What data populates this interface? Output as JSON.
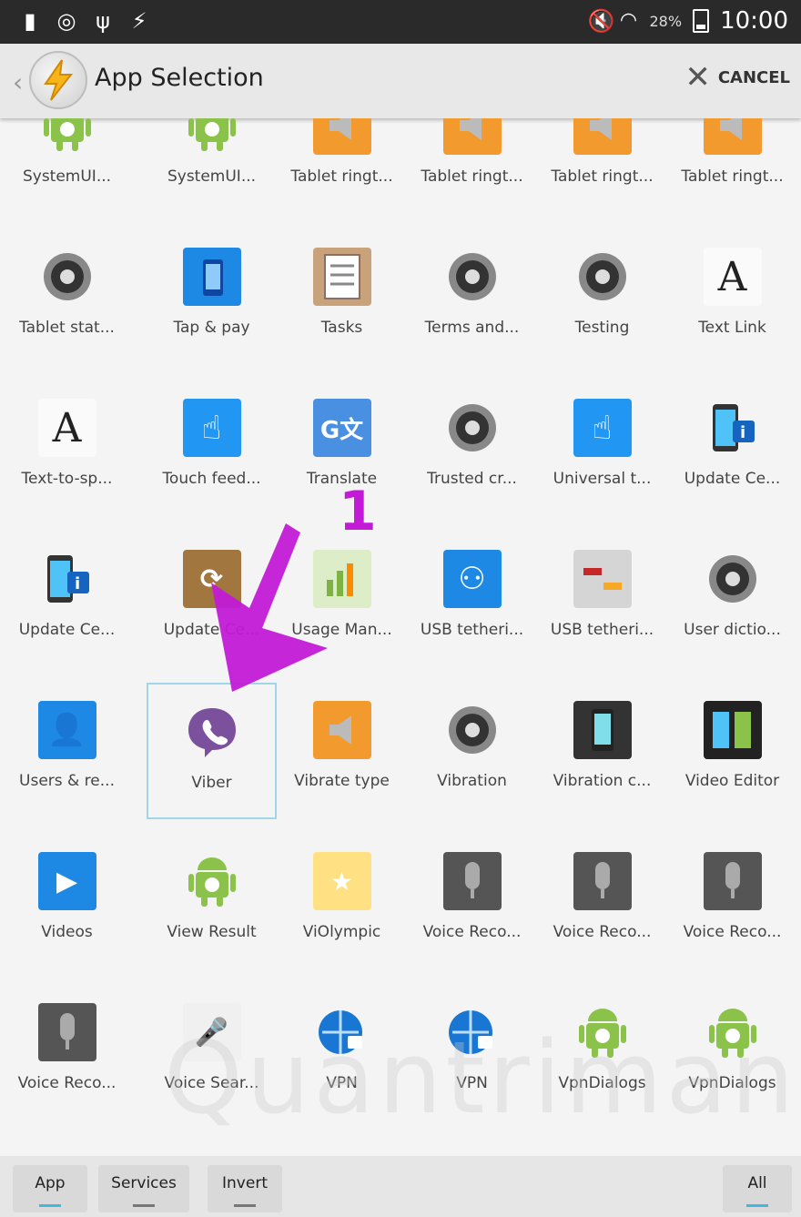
{
  "status_bar": {
    "battery_percent": "28%",
    "time": "10:00"
  },
  "action_bar": {
    "title": "App Selection",
    "cancel_label": "CANCEL"
  },
  "apps": [
    {
      "label": "SystemUI...",
      "icon": "android-icon"
    },
    {
      "label": "SystemUI...",
      "icon": "android-icon"
    },
    {
      "label": "Tablet ringt...",
      "icon": "speaker-icon"
    },
    {
      "label": "Tablet ringt...",
      "icon": "speaker-icon"
    },
    {
      "label": "Tablet ringt...",
      "icon": "speaker-icon"
    },
    {
      "label": "Tablet ringt...",
      "icon": "speaker-icon"
    },
    {
      "label": "Tablet stat...",
      "icon": "gear-icon"
    },
    {
      "label": "Tap & pay",
      "icon": "nfc-phone-icon"
    },
    {
      "label": "Tasks",
      "icon": "checklist-icon"
    },
    {
      "label": "Terms and...",
      "icon": "gear-icon"
    },
    {
      "label": "Testing",
      "icon": "gear-icon"
    },
    {
      "label": "Text Link",
      "icon": "letter-a-icon"
    },
    {
      "label": "Text-to-sp...",
      "icon": "letter-a-icon"
    },
    {
      "label": "Touch feed...",
      "icon": "touch-hand-icon"
    },
    {
      "label": "Translate",
      "icon": "translate-icon"
    },
    {
      "label": "Trusted cr...",
      "icon": "gear-icon"
    },
    {
      "label": "Universal t...",
      "icon": "touch-hand-icon"
    },
    {
      "label": "Update Ce...",
      "icon": "phone-update-icon"
    },
    {
      "label": "Update Ce...",
      "icon": "phone-update-icon"
    },
    {
      "label": "Update Ce...",
      "icon": "package-update-icon"
    },
    {
      "label": "Usage Man...",
      "icon": "bar-chart-icon"
    },
    {
      "label": "USB tetheri...",
      "icon": "usb-icon"
    },
    {
      "label": "USB tetheri...",
      "icon": "usb-cable-icon"
    },
    {
      "label": "User dictio...",
      "icon": "gear-icon"
    },
    {
      "label": "Users & re...",
      "icon": "users-icon"
    },
    {
      "label": "Viber",
      "icon": "viber-icon"
    },
    {
      "label": "Vibrate type",
      "icon": "speaker-icon"
    },
    {
      "label": "Vibration",
      "icon": "gear-icon"
    },
    {
      "label": "Vibration c...",
      "icon": "phone-vibrate-icon"
    },
    {
      "label": "Video Editor",
      "icon": "film-strip-icon"
    },
    {
      "label": "Videos",
      "icon": "clapperboard-icon"
    },
    {
      "label": "View Result",
      "icon": "android-icon"
    },
    {
      "label": "ViOlympic",
      "icon": "game-icon"
    },
    {
      "label": "Voice Reco...",
      "icon": "microphone-icon"
    },
    {
      "label": "Voice Reco...",
      "icon": "microphone-icon"
    },
    {
      "label": "Voice Reco...",
      "icon": "microphone-icon"
    },
    {
      "label": "Voice Reco...",
      "icon": "microphone-icon"
    },
    {
      "label": "Voice Sear...",
      "icon": "voice-search-icon"
    },
    {
      "label": "VPN",
      "icon": "vpn-globe-icon"
    },
    {
      "label": "VPN",
      "icon": "vpn-globe-icon"
    },
    {
      "label": "VpnDialogs",
      "icon": "android-icon"
    },
    {
      "label": "VpnDialogs",
      "icon": "android-icon"
    }
  ],
  "selected_app": "Viber",
  "annotation": {
    "label": "1",
    "color": "#c21ad6"
  },
  "bottom_bar": {
    "app_label": "App",
    "services_label": "Services",
    "invert_label": "Invert",
    "all_label": "All"
  },
  "colors": {
    "accent": "#45b6e0",
    "selection_border": "#9fd6e8"
  }
}
